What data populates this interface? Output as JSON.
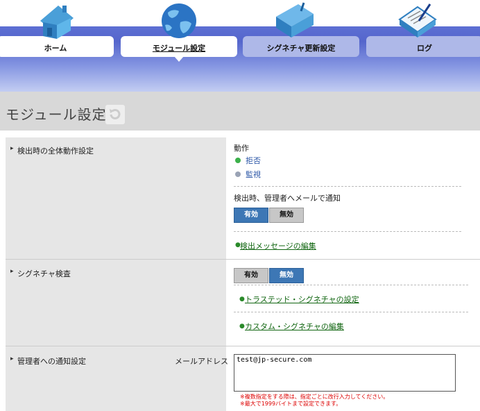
{
  "nav": {
    "tabs": [
      {
        "label": "ホーム",
        "icon": "house-icon"
      },
      {
        "label": "モジュール設定",
        "icon": "globe-icon"
      },
      {
        "label": "シグネチャ更新設定",
        "icon": "binder-icon"
      },
      {
        "label": "ログ",
        "icon": "clipboard-icon"
      }
    ]
  },
  "page": {
    "title": "モジュール設定"
  },
  "section1": {
    "label": "検出時の全体動作設定",
    "action_heading": "動作",
    "radio_options": [
      "拒否",
      "監視"
    ],
    "notify_heading": "検出時、管理者へメールで通知",
    "btn_on": "有効",
    "btn_off": "無効",
    "link_edit_message": "検出メッセージの編集"
  },
  "section2": {
    "label": "シグネチャ検査",
    "btn_on": "有効",
    "btn_off": "無効",
    "link_trusted": "トラステッド・シグネチャの設定",
    "link_custom": "カスタム・シグネチャの編集"
  },
  "section3": {
    "label": "管理者への通知設定",
    "field_label": "メールアドレス",
    "email_value": "test@jp-secure.com",
    "note1": "※複数指定をする際は、指定ごとに改行入力してください。",
    "note2": "※最大で1999バイトまで設定できます。"
  },
  "colors": {
    "accent_blue": "#3d77b5",
    "nav_blue": "#5566cc",
    "link_green": "#116611",
    "note_red": "#dd0000"
  }
}
